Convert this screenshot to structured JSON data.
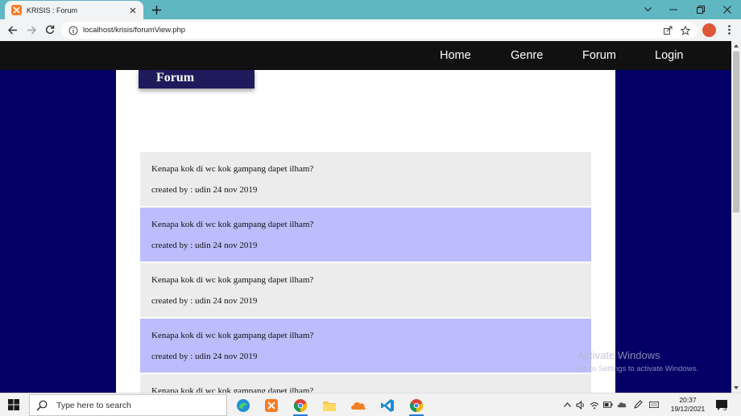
{
  "browser": {
    "tab_title": "KRISIS : Forum",
    "url": "localhost/krisis/forumView.php"
  },
  "navbar": {
    "items": [
      {
        "label": "Home"
      },
      {
        "label": "Genre"
      },
      {
        "label": "Forum"
      },
      {
        "label": "Login"
      }
    ]
  },
  "page": {
    "badge": "Forum",
    "posts": [
      {
        "question": "Kenapa kok di wc kok gampang dapet ilham?",
        "meta": "created by : udin 24 nov 2019",
        "style": "grey"
      },
      {
        "question": "Kenapa kok di wc kok gampang dapet ilham?",
        "meta": "created by : udin 24 nov 2019",
        "style": "blue"
      },
      {
        "question": "Kenapa kok di wc kok gampang dapet ilham?",
        "meta": "created by : udin 24 nov 2019",
        "style": "grey"
      },
      {
        "question": "Kenapa kok di wc kok gampang dapet ilham?",
        "meta": "created by : udin 24 nov 2019",
        "style": "blue"
      },
      {
        "question": "Kenapa kok di wc kok gampang dapet ilham?",
        "meta": "",
        "style": "grey"
      }
    ]
  },
  "watermark": {
    "line1": "Activate Windows",
    "line2": "Go to Settings to activate Windows."
  },
  "taskbar": {
    "search_placeholder": "Type here to search",
    "time": "20:37",
    "date": "19/12/2021",
    "notifications": "5",
    "apps": [
      "edge-icon",
      "xampp-icon",
      "chrome-icon",
      "file-explorer-icon",
      "cloud-icon",
      "vscode-icon",
      "chrome-icon"
    ]
  },
  "colors": {
    "navbar_bg": "#111111",
    "page_bg": "#020066",
    "badge_bg": "#1f1a5c",
    "post_grey": "#ececec",
    "post_blue": "#bdbdfd"
  }
}
